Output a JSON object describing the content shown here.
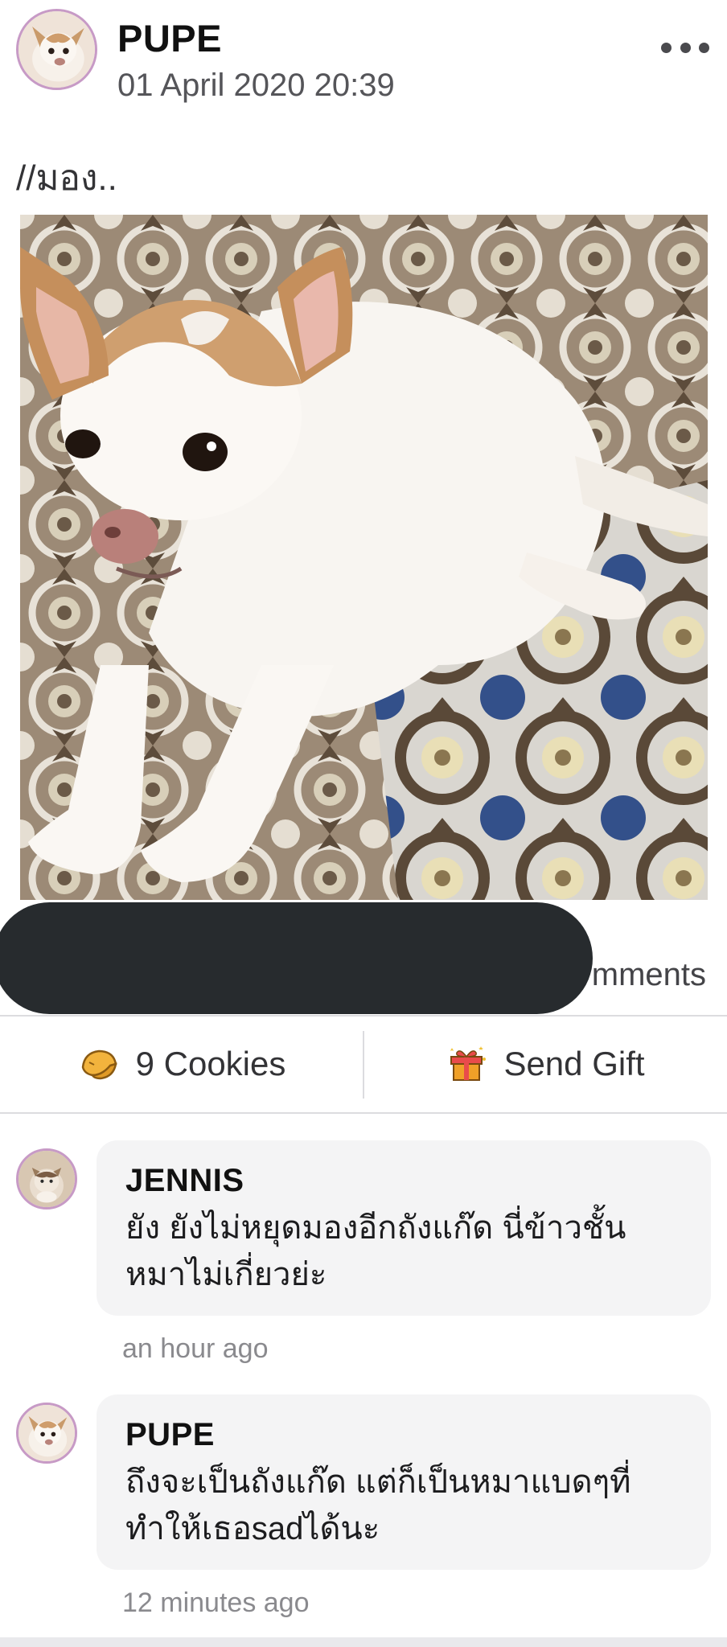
{
  "post": {
    "author": "PUPE",
    "timestamp": "01 April 2020 20:39",
    "text": "//มอง..",
    "more_icon": "more-horizontal-icon",
    "comments_count_visible": "mments"
  },
  "actions": {
    "cookies_label": "9 Cookies",
    "cookies_icon": "cookie-icon",
    "gift_label": "Send Gift",
    "gift_icon": "gift-icon"
  },
  "comments": [
    {
      "author": "JENNIS",
      "text": "ยัง ยังไม่หยุดมองอีกถังแก๊ด นี่ข้าวชั้นหมาไม่เกี่ยวย่ะ",
      "time": "an hour ago"
    },
    {
      "author": "PUPE",
      "text": "ถึงจะเป็นถังแก๊ด แต่ก็เป็นหมาแบดๆที่ทำให้เธอsadได้นะ",
      "time": "12 minutes ago"
    }
  ],
  "colors": {
    "avatar_border": "#c79ac6",
    "redaction": "#272b2e",
    "bubble_bg": "#f4f4f5",
    "divider": "#dcdcdf"
  }
}
